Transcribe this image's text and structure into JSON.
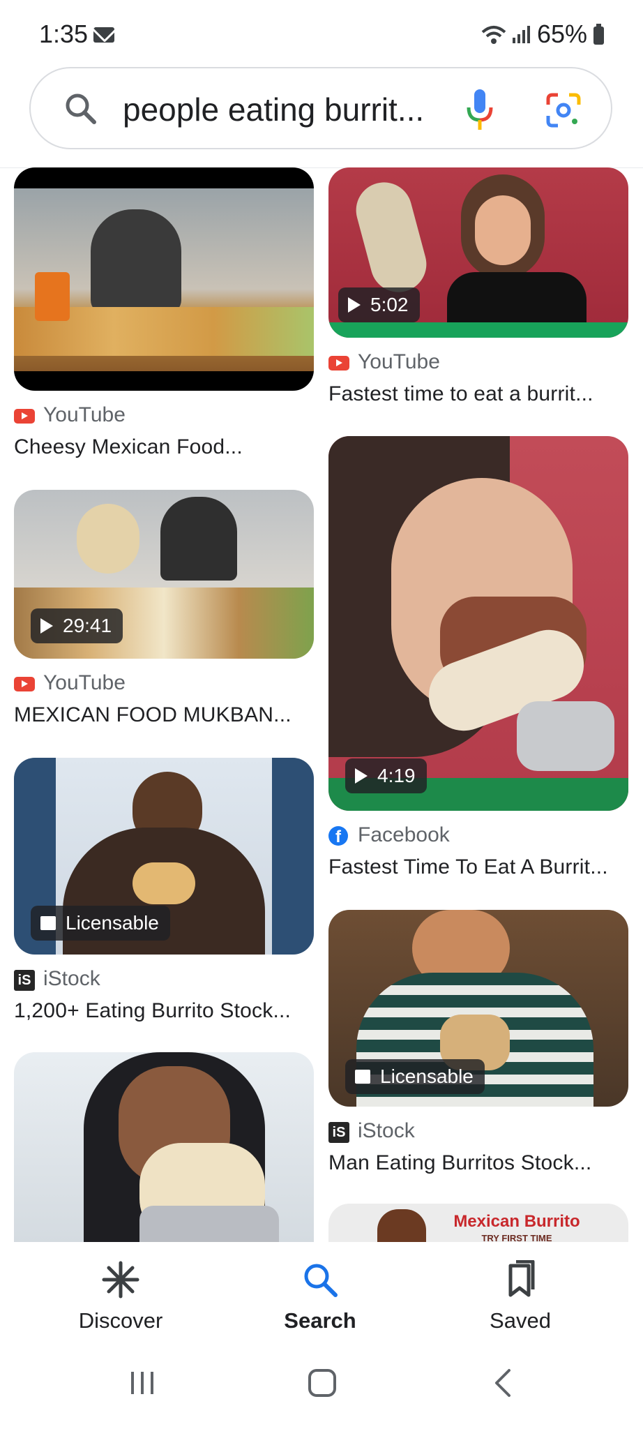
{
  "status_bar": {
    "time": "1:35",
    "battery": "65%"
  },
  "search": {
    "query": "people eating burrit..."
  },
  "results": [
    {
      "source": "YouTube",
      "title": "Cheesy Mexican Food..."
    },
    {
      "source": "YouTube",
      "title": "Fastest time to eat a burrit...",
      "duration": "5:02"
    },
    {
      "source": "YouTube",
      "title": "MEXICAN FOOD MUKBAN...",
      "duration": "29:41"
    },
    {
      "source": "Facebook",
      "title": "Fastest Time To Eat A Burrit...",
      "duration": "4:19"
    },
    {
      "source": "iStock",
      "title": "1,200+ Eating Burrito Stock...",
      "badge": "Licensable"
    },
    {
      "source": "iStock",
      "title": "Man Eating Burritos Stock...",
      "badge": "Licensable"
    },
    {
      "title_overlay_line1": "Mexican Burrito",
      "title_overlay_line2": "TRY FIRST TIME"
    }
  ],
  "bottom_nav": {
    "discover": "Discover",
    "search": "Search",
    "saved": "Saved"
  },
  "colors": {
    "accent_blue": "#1a73e8",
    "youtube_red": "#ea4335",
    "facebook_blue": "#1877f2"
  }
}
